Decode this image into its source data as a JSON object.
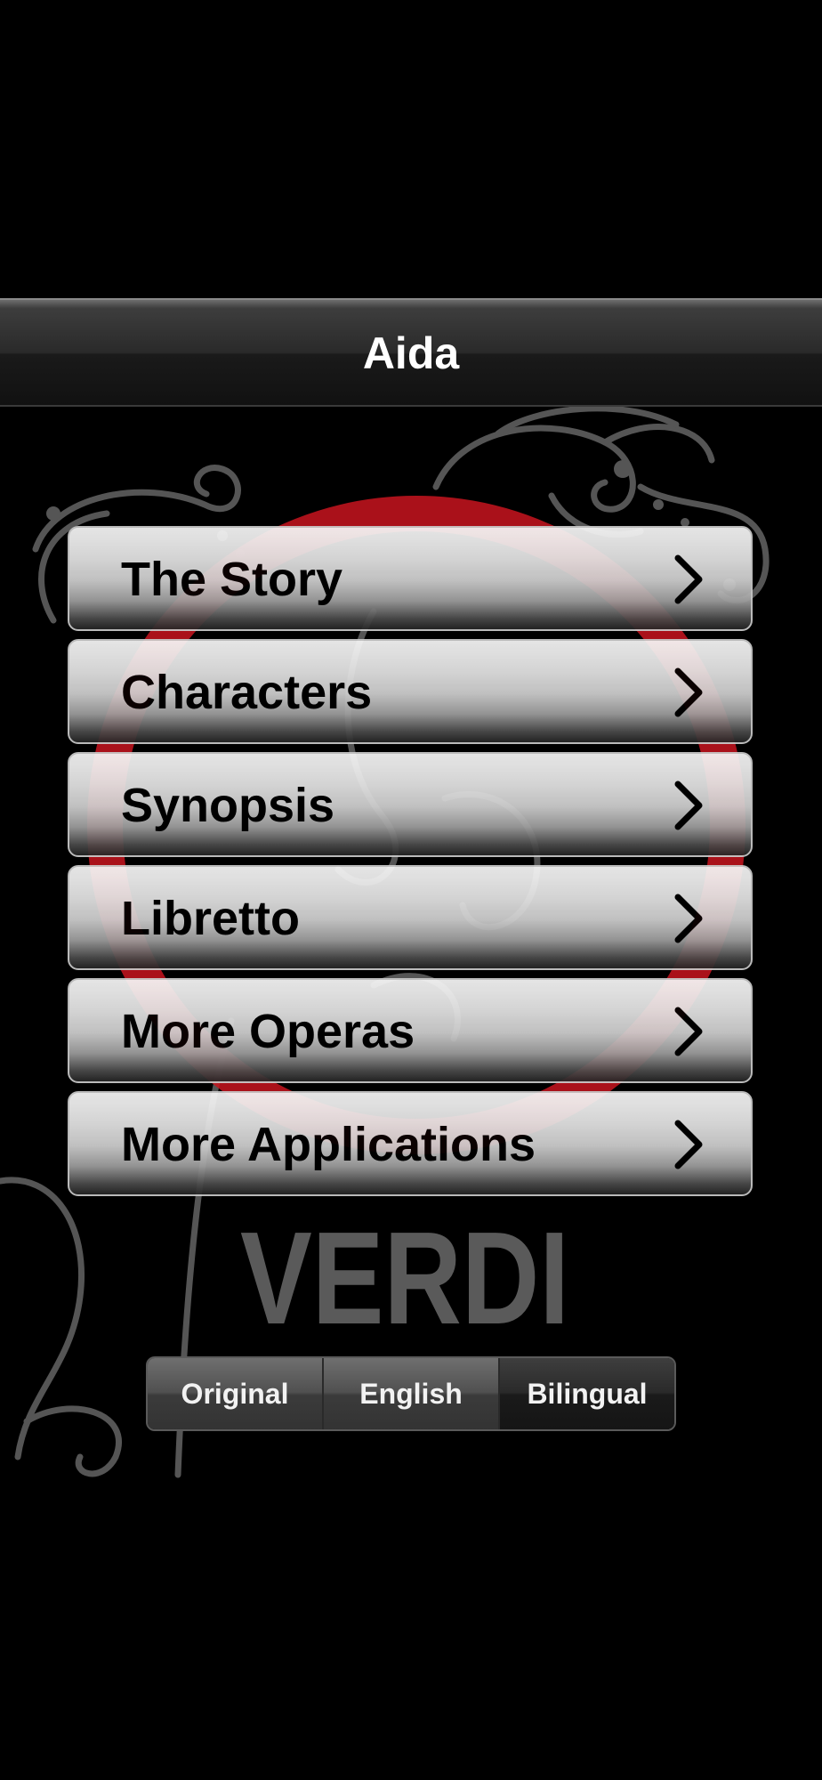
{
  "navbar": {
    "title": "Aida"
  },
  "menu": {
    "items": [
      {
        "label": "The Story",
        "icon": "chevron-right-icon"
      },
      {
        "label": "Characters",
        "icon": "chevron-right-icon"
      },
      {
        "label": "Synopsis",
        "icon": "chevron-right-icon"
      },
      {
        "label": "Libretto",
        "icon": "chevron-right-icon"
      },
      {
        "label": "More Operas",
        "icon": "chevron-right-icon"
      },
      {
        "label": "More Applications",
        "icon": "chevron-right-icon"
      }
    ]
  },
  "logo": {
    "text": "VERDI"
  },
  "language": {
    "options": [
      "Original",
      "English",
      "Bilingual"
    ],
    "selected": "Bilingual"
  },
  "colors": {
    "background": "#000000",
    "accent_red": "#c8141e",
    "logo_gray": "#5a5a5a"
  }
}
